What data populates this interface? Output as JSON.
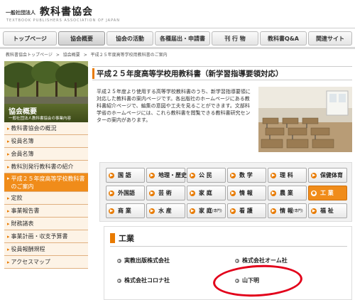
{
  "header": {
    "logo_sub": "一般社団法人",
    "logo_main": "教科書協会",
    "logo_en": "TEXTBOOK PUBLISHERS ASSOCIATION OF JAPAN"
  },
  "gnav": [
    {
      "label": "トップページ",
      "active": false
    },
    {
      "label": "協会概要",
      "active": true
    },
    {
      "label": "協会の活動",
      "active": false
    },
    {
      "label": "各種届出・申請書",
      "active": false
    },
    {
      "label": "刊 行 物",
      "active": false
    },
    {
      "label": "教科書Q&A",
      "active": false
    },
    {
      "label": "関連サイト",
      "active": false
    }
  ],
  "breadcrumb": {
    "home": "教科書協会トップページ",
    "sep": ">",
    "parent": "協会概要",
    "current": "平成２５年度高等学校用教科書のご案内"
  },
  "sidebar": {
    "heading": "協会概要",
    "subheading": "一般社団法人教科書協会の事業内容",
    "items": [
      {
        "label": "教科書協会の概況"
      },
      {
        "label": "役員名簿"
      },
      {
        "label": "会員名簿"
      },
      {
        "label": "教科別発行教科書の紹介"
      },
      {
        "label": "平成２５年度高等学校教科書のご案内",
        "active": true
      },
      {
        "label": "定款"
      },
      {
        "label": "事業報告書"
      },
      {
        "label": "財務諸表"
      },
      {
        "label": "事業計画・収支予算書"
      },
      {
        "label": "役員報酬規程"
      },
      {
        "label": "アクセスマップ"
      }
    ]
  },
  "main": {
    "title": "平成２５年度高等学校用教科書（新学習指導要領対応）",
    "intro": "平成２５年度より使用する高等学校教科書のうち、新学習指導要領に対応した教科書の案内ページです。各出版社のホームページにある教科書紹介ページで、編集の意図や工夫を見ることができます。文部科学省のホームページには、これら教科書を閲覧できる教科書研究センターの案内があります。"
  },
  "subjects": [
    {
      "label": "国 語"
    },
    {
      "label": "地理・歴史"
    },
    {
      "label": "公 民"
    },
    {
      "label": "数 学"
    },
    {
      "label": "理 科"
    },
    {
      "label": "保健体育"
    },
    {
      "label": "外国語"
    },
    {
      "label": "芸 術"
    },
    {
      "label": "家 庭"
    },
    {
      "label": "情 報"
    },
    {
      "label": "農 業"
    },
    {
      "label": "工 業",
      "active": true
    },
    {
      "label": "商 業"
    },
    {
      "label": "水 産"
    },
    {
      "label": "家 庭",
      "suffix": "(専門)"
    },
    {
      "label": "看 護"
    },
    {
      "label": "情 報",
      "suffix": "(専門)"
    },
    {
      "label": "福 祉"
    }
  ],
  "publishers": {
    "title": "工業",
    "items": [
      {
        "label": "実教出版株式会社"
      },
      {
        "label": "株式会社オーム社"
      },
      {
        "label": "株式会社コロナ社"
      },
      {
        "label": "山下明"
      }
    ]
  },
  "colors": {
    "accent": "#f08c1a",
    "sidebar_bg": "#fdf3e6",
    "annotation": "#e2001a"
  }
}
